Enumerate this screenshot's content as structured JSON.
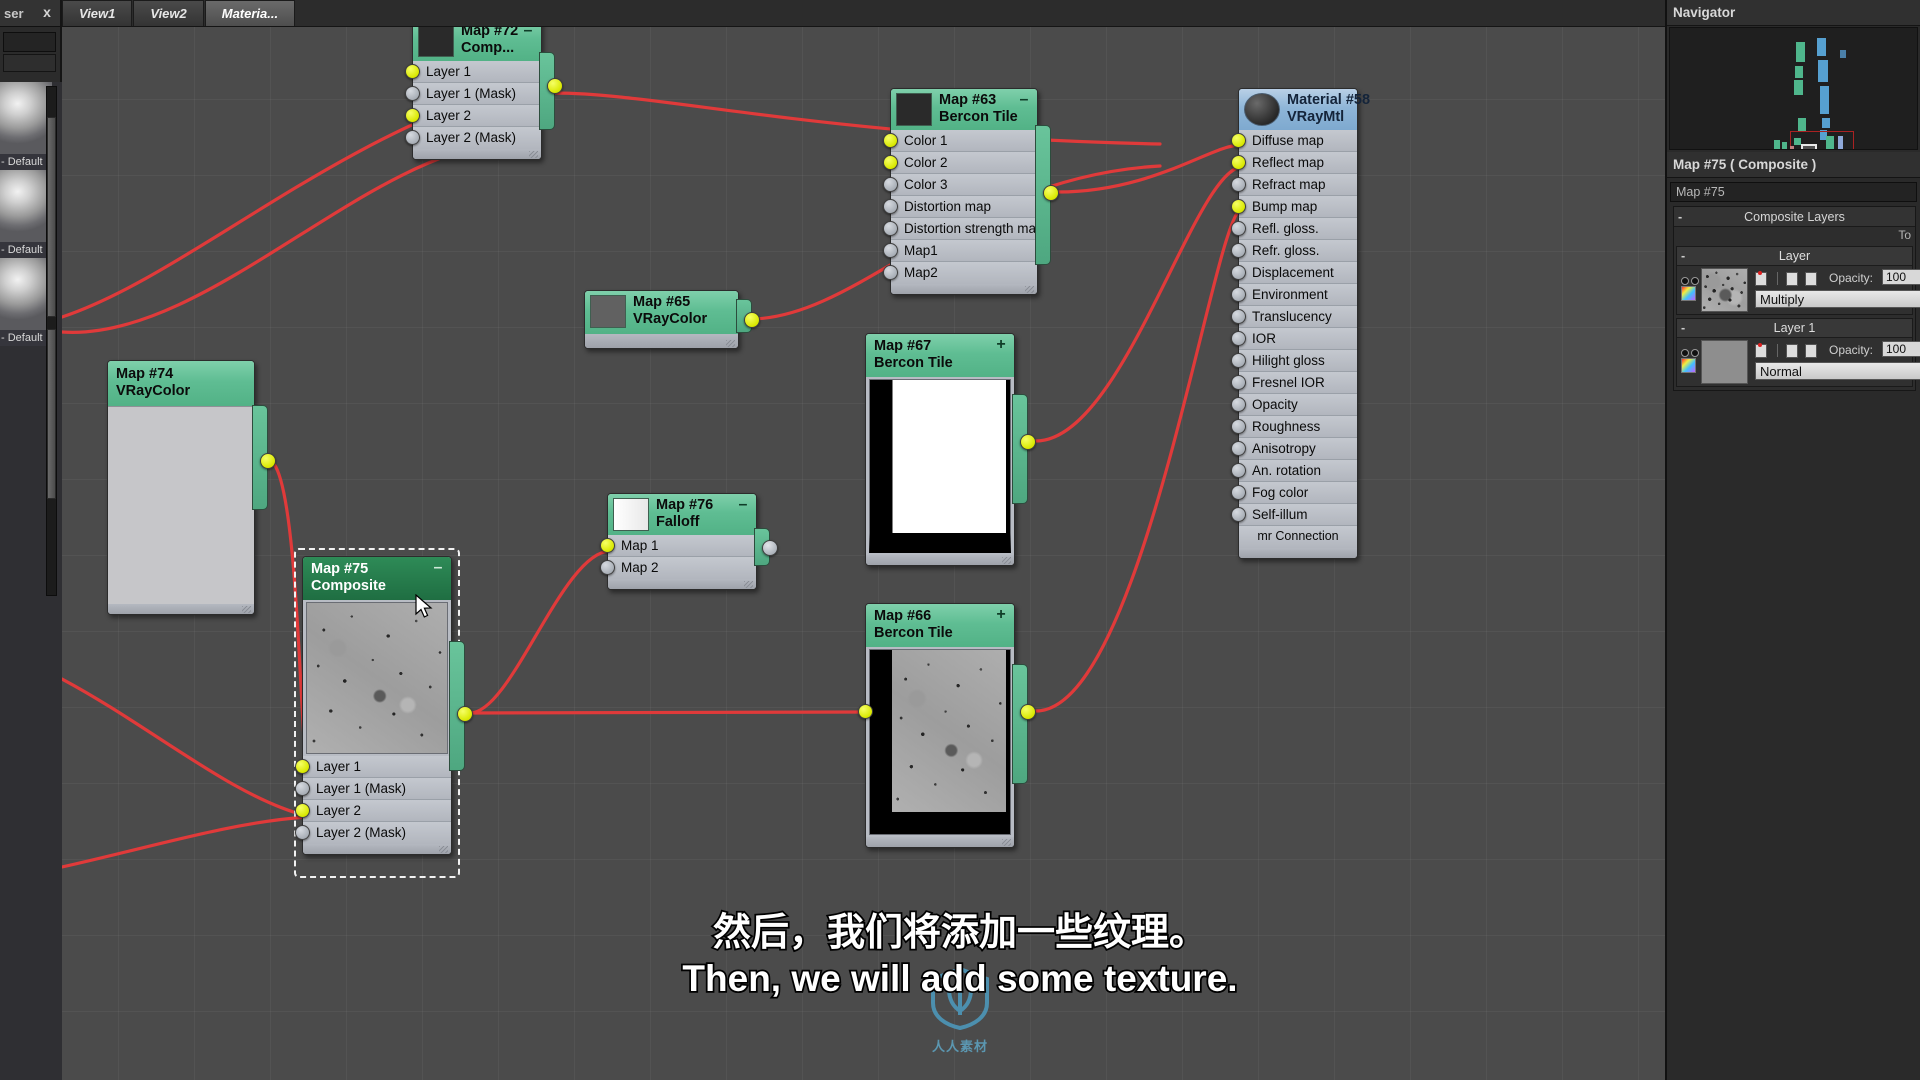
{
  "browser": {
    "title": "ser",
    "close_label": "x",
    "materials": [
      {
        "label": "- Default"
      },
      {
        "label": "- Default"
      },
      {
        "label": "- Default"
      }
    ]
  },
  "tabs": [
    {
      "label": "View1",
      "active": false
    },
    {
      "label": "View2",
      "active": false
    },
    {
      "label": "Materia...",
      "active": true
    }
  ],
  "nodes": {
    "map72": {
      "id": "Map #72",
      "type": "Comp...",
      "collapse_icon": "–",
      "slots": [
        "Layer 1",
        "Layer 1 (Mask)",
        "Layer 2",
        "Layer 2 (Mask)"
      ]
    },
    "map63": {
      "id": "Map #63",
      "type": "Bercon Tile",
      "collapse_icon": "–",
      "slots": [
        "Color 1",
        "Color 2",
        "Color 3",
        "Distortion map",
        "Distortion strength map",
        "Map1",
        "Map2"
      ]
    },
    "map65": {
      "id": "Map #65",
      "type": "VRayColor",
      "swatch": "#616161"
    },
    "map74": {
      "id": "Map #74",
      "type": "VRayColor",
      "swatch": "#c6c6c9"
    },
    "map75": {
      "id": "Map #75",
      "type": "Composite",
      "collapse_icon": "–",
      "slots": [
        "Layer 1",
        "Layer 1 (Mask)",
        "Layer 2",
        "Layer 2 (Mask)"
      ],
      "selected": true
    },
    "map76": {
      "id": "Map #76",
      "type": "Falloff",
      "collapse_icon": "–",
      "slots": [
        "Map 1",
        "Map 2"
      ]
    },
    "map67": {
      "id": "Map #67",
      "type": "Bercon Tile",
      "expand_icon": "+"
    },
    "map66": {
      "id": "Map #66",
      "type": "Bercon Tile",
      "expand_icon": "+"
    },
    "material58": {
      "id": "Material #58",
      "type": "VRayMtl",
      "slots": [
        "Diffuse map",
        "Reflect map",
        "Refract map",
        "Bump map",
        "Refl. gloss.",
        "Refr. gloss.",
        "Displacement",
        "Environment",
        "Translucency",
        "IOR",
        "Hilight gloss",
        "Fresnel IOR",
        "Opacity",
        "Roughness",
        "Anisotropy",
        "An. rotation",
        "Fog color",
        "Self-illum"
      ],
      "footer": "mr Connection"
    }
  },
  "right_panel": {
    "navigator_title": "Navigator",
    "param_title": "Map #75  ( Composite )",
    "name_value": "Map #75",
    "rollout_title": "Composite Layers",
    "rollout_minus": "-",
    "total_label": "To",
    "layers": [
      {
        "name": "Layer",
        "minus": "-",
        "opacity_label": "Opacity:",
        "opacity_value": "100",
        "blend": "Multiply"
      },
      {
        "name": "Layer 1",
        "minus": "-",
        "opacity_label": "Opacity:",
        "opacity_value": "100",
        "blend": "Normal"
      }
    ]
  },
  "subtitles": {
    "chinese": "然后，我们将添加一些纹理。",
    "english": "Then, we will add some texture."
  },
  "watermark": {
    "text": "人人素材"
  },
  "colors": {
    "wire": "#e03a3a",
    "node_header_green": "#5fbd93",
    "node_header_blue": "#8fb6d8",
    "port_active": "#e4f000",
    "port_inactive": "#b5bac1",
    "canvas": "#4b4b4b",
    "selection": "#f2f2f2"
  }
}
